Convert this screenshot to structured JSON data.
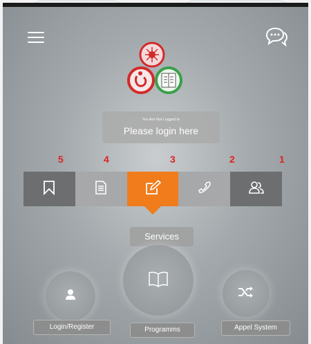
{
  "header": {
    "menu_icon": "hamburger-menu-icon",
    "chat_icon": "chat-bubbles-icon"
  },
  "login_banner": {
    "subtitle": "You Are Not Logged In",
    "title": "Please login here"
  },
  "annotations": [
    "5",
    "4",
    "3",
    "2",
    "1"
  ],
  "tabs": [
    {
      "icon": "bookmark-icon",
      "state": "default"
    },
    {
      "icon": "document-icon",
      "state": "default"
    },
    {
      "icon": "edit-icon",
      "state": "active"
    },
    {
      "icon": "phone-icon",
      "state": "default"
    },
    {
      "icon": "users-icon",
      "state": "default"
    }
  ],
  "section": {
    "label": "Services"
  },
  "actions": [
    {
      "label": "Login/Register",
      "icon": "user-icon"
    },
    {
      "label": "Programms",
      "icon": "book-icon"
    },
    {
      "label": "Appel System",
      "icon": "shuffle-icon"
    }
  ],
  "colors": {
    "accent": "#f07c1c",
    "annotation_red": "#dd2222",
    "tab_dark": "#6c6e70",
    "tab_light": "#a6a8a9",
    "logo_red": "#d32a2a",
    "logo_green": "#3aa04a"
  }
}
